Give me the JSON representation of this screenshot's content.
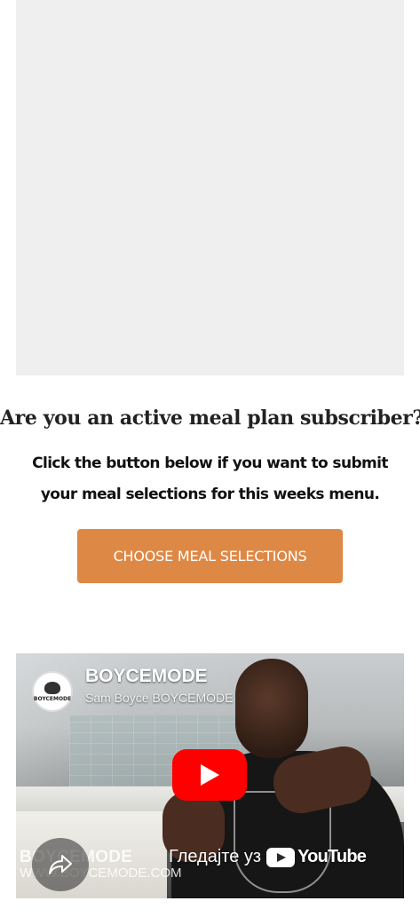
{
  "headline": "Are you an active meal plan subscriber?",
  "subtext": "Click the button below if you want to submit your meal selections for this weeks menu.",
  "cta_button": {
    "label": "CHOOSE MEAL SELECTIONS",
    "color": "#de8846"
  },
  "video": {
    "title": "BOYCEMODE",
    "subtitle": "Sam Boyce BOYCEMODE",
    "channel_logo_text": "BOYCEMODE",
    "watermark_brand": "BOYCEMODE",
    "watermark_site": "WWW.BOYCEMODE.COM",
    "watch_on_label": "Гледајте уз",
    "youtube_wordmark": "YouTube",
    "play_icon": "play-icon",
    "share_icon": "share-icon",
    "play_color": "#ff0000"
  }
}
